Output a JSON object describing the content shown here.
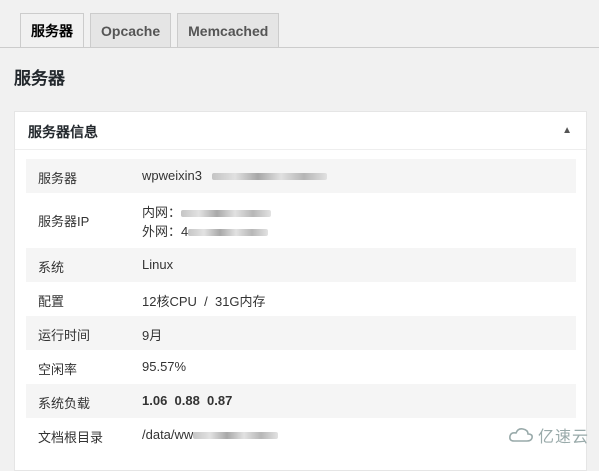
{
  "tabs": [
    "服务器",
    "Opcache",
    "Memcached"
  ],
  "page_title": "服务器",
  "box": {
    "title": "服务器信息",
    "toggle_icon": "▲"
  },
  "rows": {
    "server": {
      "label": "服务器",
      "value": "wpweixin3"
    },
    "server_ip": {
      "label": "服务器IP",
      "internal": "内网：",
      "external": "外网：4"
    },
    "os": {
      "label": "系统",
      "value": "Linux"
    },
    "config": {
      "label": "配置",
      "value": "12核CPU  /  31G内存"
    },
    "uptime": {
      "label": "运行时间",
      "value": "9月"
    },
    "idle": {
      "label": "空闲率",
      "value": "95.57%"
    },
    "load": {
      "label": "系统负载",
      "value": "1.06  0.88  0.87"
    },
    "docroot": {
      "label": "文档根目录",
      "value": "/data/ww"
    }
  },
  "watermark": "亿速云"
}
